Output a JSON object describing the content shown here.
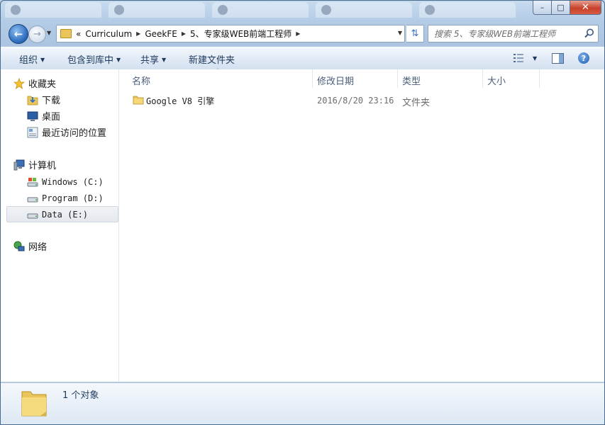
{
  "window": {
    "caption": {
      "minimize": "–",
      "maximize": "□",
      "close": "✕"
    }
  },
  "nav": {
    "back_icon": "back-arrow-icon",
    "forward_icon": "forward-arrow-icon",
    "breadcrumb_overflow": "«",
    "breadcrumbs": [
      "Curriculum",
      "GeekFE",
      "5、专家级WEB前端工程师"
    ],
    "search_placeholder": "搜索 5、专家级WEB前端工程师"
  },
  "toolbar": {
    "organize": "组织",
    "include_in_library": "包含到库中",
    "share": "共享",
    "new_folder": "新建文件夹",
    "help": "?"
  },
  "sidebar": {
    "favorites": {
      "label": "收藏夹",
      "items": [
        {
          "label": "下载",
          "icon": "downloads-icon"
        },
        {
          "label": "桌面",
          "icon": "desktop-icon"
        },
        {
          "label": "最近访问的位置",
          "icon": "recent-places-icon"
        }
      ]
    },
    "computer": {
      "label": "计算机",
      "items": [
        {
          "label": "Windows (C:)",
          "icon": "system-drive-icon"
        },
        {
          "label": "Program (D:)",
          "icon": "drive-icon"
        },
        {
          "label": "Data (E:)",
          "icon": "drive-icon",
          "selected": true
        }
      ]
    },
    "network": {
      "label": "网络"
    }
  },
  "columns": {
    "name": "名称",
    "modified": "修改日期",
    "type": "类型",
    "size": "大小"
  },
  "files": [
    {
      "name": "Google V8 引擎",
      "modified": "2016/8/20 23:16",
      "type": "文件夹",
      "size": ""
    }
  ],
  "status": {
    "text": "1 个对象"
  },
  "colors": {
    "accent": "#1e5bb0",
    "folder": "#e9c55c",
    "close": "#c7412b"
  }
}
